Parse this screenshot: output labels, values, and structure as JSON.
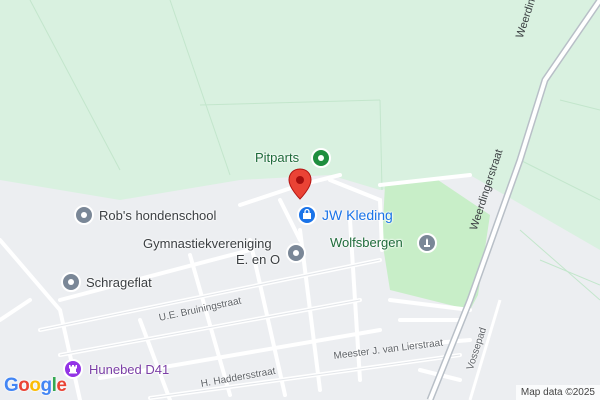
{
  "colors": {
    "forest": "#d9f1e0",
    "urban": "#eceef1",
    "park": "#c8eec8",
    "road": "#ffffff",
    "primary_road": "#b8bfc7",
    "poi_gray": "#7a8797",
    "poi_green": "#1e8e3e",
    "poi_blue": "#1a73e8",
    "poi_purple": "#9334e6",
    "marker": "#ea4335"
  },
  "pois": {
    "pitparts": {
      "label": "Pitparts",
      "icon": "pin-green-icon"
    },
    "jw_kleding": {
      "label": "JW Kleding",
      "icon": "shopping-bag-icon"
    },
    "robs": {
      "label": "Rob's hondenschool",
      "icon": "pin-gray-icon"
    },
    "gym_line1": {
      "label": "Gymnastiekvereniging",
      "icon": "pin-gray-icon"
    },
    "gym_line2": {
      "label": "E. en O"
    },
    "wolfsbergen": {
      "label": "Wolfsbergen",
      "icon": "monument-icon"
    },
    "schrageflat": {
      "label": "Schrageflat",
      "icon": "pin-gray-icon"
    },
    "hunebed": {
      "label": "Hunebed D41",
      "icon": "chess-rook-icon"
    }
  },
  "streets": {
    "weerdingerstraat_top": "Weerdingerstraat",
    "weerdingerstraat_mid": "Weerdingerstraat",
    "bruiningstraat": "U.E. Bruiningstraat",
    "haddersstraat": "H. Haddersstraat",
    "lierstraat": "Meester J. van Lierstraat",
    "vossepad": "Vossepad"
  },
  "footer": {
    "logo": "Google",
    "copyright": "Map data ©2025"
  }
}
